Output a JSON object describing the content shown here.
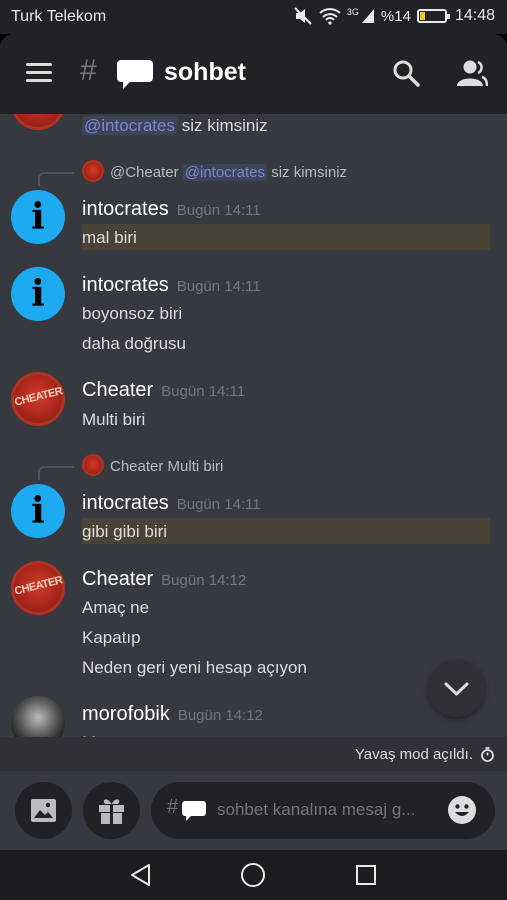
{
  "statusbar": {
    "carrier": "Turk Telekom",
    "network": "3G",
    "battery": "%14",
    "time": "14:48"
  },
  "header": {
    "hash": "#",
    "channel": "sohbet",
    "icons": [
      "menu-icon",
      "speech-bubble-icon",
      "search-icon",
      "members-icon"
    ]
  },
  "messages": {
    "top_partial": {
      "mention": "@intocrates",
      "text": "siz kimsiniz"
    },
    "reply1": {
      "author": "@Cheater",
      "mention": "@intocrates",
      "text": "siz kimsiniz"
    },
    "group1": {
      "author": "intocrates",
      "time": "Bugün 14:11",
      "lines": [
        "mal biri"
      ]
    },
    "group2": {
      "author": "intocrates",
      "time": "Bugün 14:11",
      "lines": [
        "boyonsoz biri",
        "daha doğrusu"
      ]
    },
    "group3": {
      "author": "Cheater",
      "time": "Bugün 14:11",
      "lines": [
        "Multi biri"
      ]
    },
    "reply2": {
      "author": "Cheater",
      "text": "Multi biri"
    },
    "group4": {
      "author": "intocrates",
      "time": "Bugün 14:11",
      "lines": [
        "gibi gibi biri"
      ]
    },
    "group5": {
      "author": "Cheater",
      "time": "Bugün 14:12",
      "lines": [
        "Amaç ne",
        "Kapatıp",
        "Neden geri yeni hesap açıyon"
      ]
    },
    "group6": {
      "author": "morofobik",
      "time": "Bugün 14:12",
      "partial": "M"
    },
    "avatar_letter": "i",
    "cheater_avatar_label": "CHEATER"
  },
  "slowmode": {
    "text": "Yavaş mod açıldı."
  },
  "composer": {
    "placeholder": "sohbet kanalına mesaj g..."
  },
  "colors": {
    "background": "#36393f",
    "header": "#202225",
    "mention": "#7289da",
    "highlight": "#4a4335",
    "info_avatar": "#1eaaf1"
  }
}
